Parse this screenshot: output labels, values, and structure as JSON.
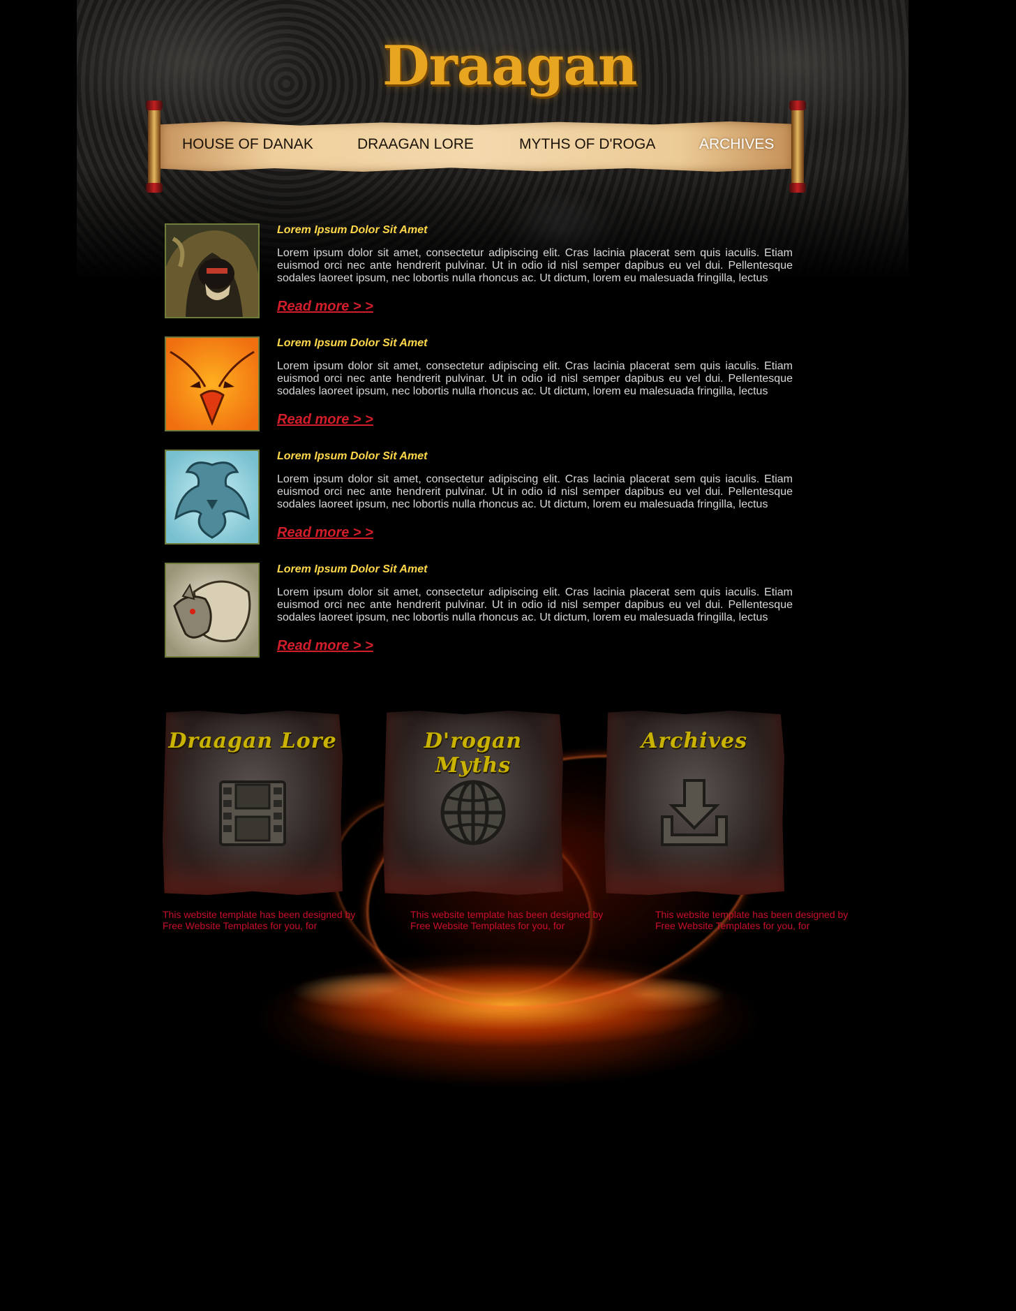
{
  "site": {
    "logo_text": "Draagan"
  },
  "nav": {
    "items": [
      {
        "label": "HOUSE OF DANAK"
      },
      {
        "label": "DRAAGAN LORE"
      },
      {
        "label": "MYTHS OF D'ROGA"
      },
      {
        "label": "ARCHIVES"
      }
    ],
    "active": "ARCHIVES"
  },
  "articles": [
    {
      "title": "Lorem Ipsum Dolor Sit Amet",
      "body": "Lorem ipsum dolor sit amet, consectetur adipiscing elit. Cras lacinia placerat sem quis iaculis. Etiam euismod orci nec ante hendrerit pulvinar. Ut in odio id nisl semper dapibus eu vel dui. Pellentesque sodales laoreet ipsum, nec lobortis nulla rhoncus ac. Ut dictum, lorem eu malesuada fringilla, lectus",
      "more": "Read more > >",
      "thumb_icon": "hooded-skull-warrior-icon"
    },
    {
      "title": "Lorem Ipsum Dolor Sit Amet",
      "body": "Lorem ipsum dolor sit amet, consectetur adipiscing elit. Cras lacinia placerat sem quis iaculis. Etiam euismod orci nec ante hendrerit pulvinar. Ut in odio id nisl semper dapibus eu vel dui. Pellentesque sodales laoreet ipsum, nec lobortis nulla rhoncus ac. Ut dictum, lorem eu malesuada fringilla, lectus",
      "more": "Read more > >",
      "thumb_icon": "orange-bird-icon"
    },
    {
      "title": "Lorem Ipsum Dolor Sit Amet",
      "body": "Lorem ipsum dolor sit amet, consectetur adipiscing elit. Cras lacinia placerat sem quis iaculis. Etiam euismod orci nec ante hendrerit pulvinar. Ut in odio id nisl semper dapibus eu vel dui. Pellentesque sodales laoreet ipsum, nec lobortis nulla rhoncus ac. Ut dictum, lorem eu malesuada fringilla, lectus",
      "more": "Read more > >",
      "thumb_icon": "ice-dragon-icon"
    },
    {
      "title": "Lorem Ipsum Dolor Sit Amet",
      "body": "Lorem ipsum dolor sit amet, consectetur adipiscing elit. Cras lacinia placerat sem quis iaculis. Etiam euismod orci nec ante hendrerit pulvinar. Ut in odio id nisl semper dapibus eu vel dui. Pellentesque sodales laoreet ipsum, nec lobortis nulla rhoncus ac. Ut dictum, lorem eu malesuada fringilla, lectus",
      "more": "Read more > >",
      "thumb_icon": "boar-icon"
    }
  ],
  "tiles": [
    {
      "title": "Draagan Lore",
      "icon": "film-strip-icon",
      "caption": "This website template has been designed by Free Website Templates for you, for"
    },
    {
      "title": "D'rogan Myths",
      "icon": "globe-icon",
      "caption": "This website template has been designed by Free Website Templates for you, for"
    },
    {
      "title": "Archives",
      "icon": "download-tray-icon",
      "caption": "This website template has been designed by Free Website Templates for you, for"
    }
  ],
  "colors": {
    "article_title": "#ffd84a",
    "read_more": "#d21e2a",
    "caption": "#c8102a",
    "logo": "#e8a520",
    "tile_title": "#c9b200"
  }
}
